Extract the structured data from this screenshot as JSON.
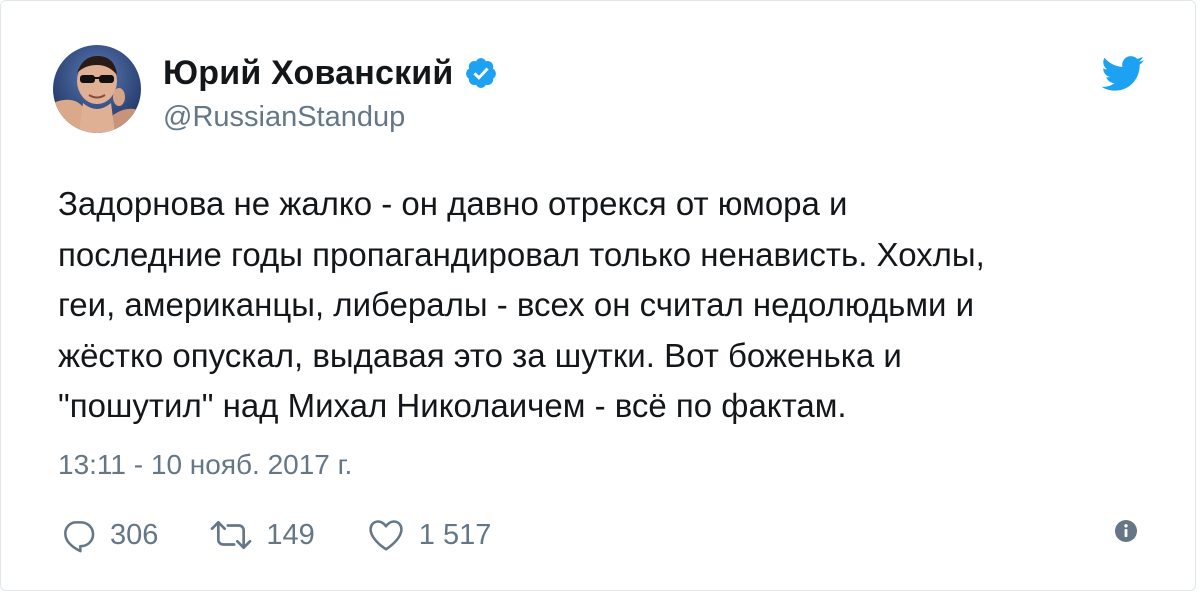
{
  "author": {
    "display_name": "Юрий Хованский",
    "handle": "@RussianStandup",
    "verified_icon": "verified-badge-icon",
    "avatar": "avatar-photo"
  },
  "brand": {
    "icon": "twitter-bird-icon",
    "color": "#1da1f2"
  },
  "tweet": {
    "lines": [
      "Задорнова не жалко - он давно отрекся от юмора и",
      "последние годы пропагандировал только ненависть. Хохлы,",
      "геи, американцы, либералы - всех он считал недолюдьми и",
      "жёстко опускал, выдавая это за шутки. Вот боженька и",
      "\"пошутил\" над Михал Николаичем - всё по фактам."
    ],
    "timestamp": "13:11 - 10 нояб. 2017 г."
  },
  "actions": {
    "replies": {
      "icon": "reply-icon",
      "count": "306"
    },
    "retweets": {
      "icon": "retweet-icon",
      "count": "149"
    },
    "likes": {
      "icon": "heart-icon",
      "count": "1 517"
    },
    "info": {
      "icon": "info-icon"
    }
  },
  "colors": {
    "text": "#14171a",
    "secondary": "#657786",
    "accent": "#1da1f2",
    "border": "#e1e8ed"
  }
}
